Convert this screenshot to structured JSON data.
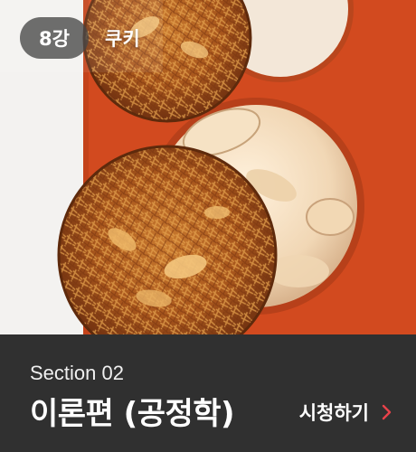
{
  "badges": {
    "lesson": "8강",
    "topic": "쿠키"
  },
  "footer": {
    "section": "Section 02",
    "title": "이론편 (공정학)",
    "watch_label": "시청하기"
  },
  "colors": {
    "tray": "#d24a1f",
    "footer_bg": "#303030",
    "chevron": "#e8424a",
    "badge_bg": "#464646"
  },
  "icons": {
    "watch": "chevron-right-icon"
  }
}
